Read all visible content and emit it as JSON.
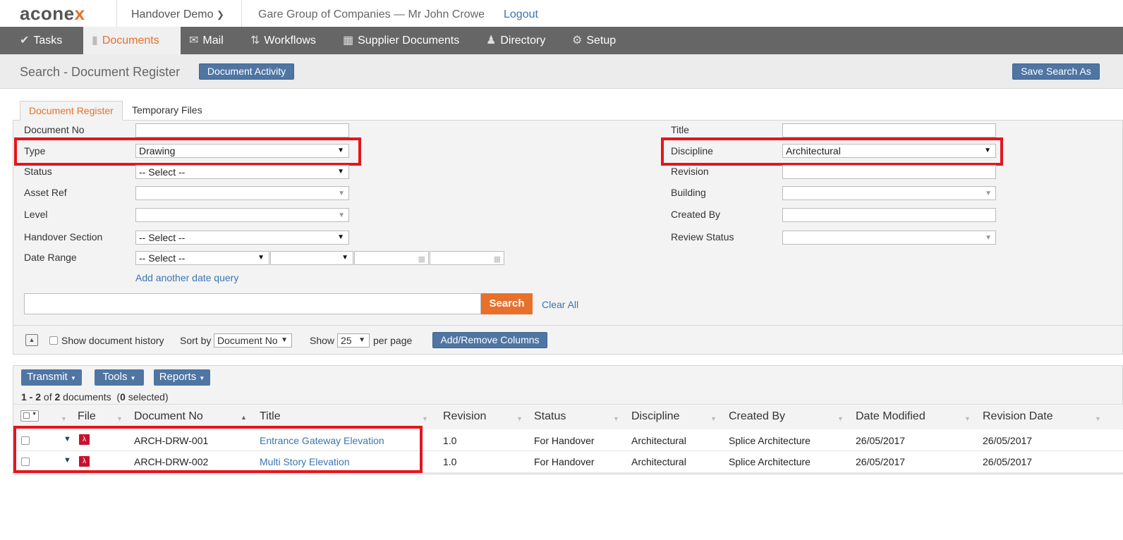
{
  "brand": {
    "logo_pre": "acone",
    "logo_x": "x"
  },
  "top": {
    "project": "Handover Demo",
    "company_user": "Gare Group of Companies  —  Mr John Crowe",
    "logout": "Logout"
  },
  "nav": {
    "tasks": "Tasks",
    "documents": "Documents",
    "mail": "Mail",
    "workflows": "Workflows",
    "supplier_documents": "Supplier Documents",
    "directory": "Directory",
    "setup": "Setup"
  },
  "header": {
    "title": "Search - Document Register",
    "document_activity": "Document Activity",
    "save_search_as": "Save Search As"
  },
  "tabs": {
    "document_register": "Document Register",
    "temporary_files": "Temporary Files"
  },
  "form": {
    "document_no": {
      "label": "Document No",
      "value": ""
    },
    "type": {
      "label": "Type",
      "value": "Drawing"
    },
    "status": {
      "label": "Status",
      "value": "-- Select --"
    },
    "asset_ref": {
      "label": "Asset Ref",
      "value": ""
    },
    "level": {
      "label": "Level",
      "value": ""
    },
    "handover_section": {
      "label": "Handover Section",
      "value": "-- Select --"
    },
    "date_range": {
      "label": "Date Range",
      "value": "-- Select --"
    },
    "add_date_query": "Add another date query",
    "title": {
      "label": "Title",
      "value": ""
    },
    "discipline": {
      "label": "Discipline",
      "value": "Architectural"
    },
    "revision": {
      "label": "Revision",
      "value": ""
    },
    "building": {
      "label": "Building",
      "value": ""
    },
    "created_by": {
      "label": "Created By",
      "value": ""
    },
    "review_status": {
      "label": "Review Status",
      "value": ""
    },
    "search_button": "Search",
    "clear_all": "Clear All"
  },
  "options": {
    "show_history": "Show document history",
    "sort_by_label": "Sort by",
    "sort_by_value": "Document No",
    "show_label": "Show",
    "show_value": "25",
    "per_page": "per page",
    "add_remove_columns": "Add/Remove Columns"
  },
  "results": {
    "transmit": "Transmit",
    "tools": "Tools",
    "reports": "Reports",
    "count_range": "1 - 2",
    "count_of": "of",
    "count_total": "2",
    "count_docs": "documents",
    "count_selected": "0",
    "count_selected_label": "selected",
    "columns": [
      "File",
      "Document No",
      "Title",
      "Revision",
      "Status",
      "Discipline",
      "Created By",
      "Date Modified",
      "Revision Date"
    ],
    "rows": [
      {
        "doc_no": "ARCH-DRW-001",
        "title": "Entrance Gateway Elevation",
        "revision": "1.0",
        "status": "For Handover",
        "discipline": "Architectural",
        "created_by": "Splice Architecture",
        "date_modified": "26/05/2017",
        "revision_date": "26/05/2017"
      },
      {
        "doc_no": "ARCH-DRW-002",
        "title": "Multi Story Elevation",
        "revision": "1.0",
        "status": "For Handover",
        "discipline": "Architectural",
        "created_by": "Splice Architecture",
        "date_modified": "26/05/2017",
        "revision_date": "26/05/2017"
      }
    ]
  },
  "colors": {
    "accent": "#e8702a",
    "nav_bg": "#666666",
    "button_blue": "#4f75a3",
    "highlight_red": "#e3161d",
    "link": "#3a75b0"
  }
}
